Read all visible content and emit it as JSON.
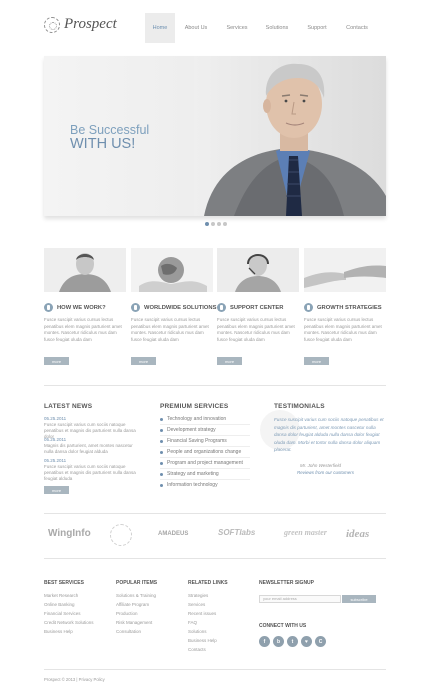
{
  "header": {
    "logo": "Prospect",
    "nav": [
      "Home",
      "About Us",
      "Services",
      "Solutions",
      "Support",
      "Contacts"
    ]
  },
  "slider": {
    "line1": "Be Successful",
    "line2": "WITH US!"
  },
  "features": [
    {
      "title": "HOW WE WORK?",
      "text": "Fusce suscipit varius cursus lectus penatibus elem magnis parturient amet montes. Nascetur ridiculus mus dam fusce feugiat oluda dam",
      "more": "more"
    },
    {
      "title": "WORLDWIDE SOLUTIONS",
      "text": "Fusce suscipit varius cursus lectus penatibus elem magnis parturient amet montes. Nascetur ridiculus mus dam fusce feugiat oluda dam",
      "more": "more"
    },
    {
      "title": "SUPPORT CENTER",
      "text": "Fusce suscipit varius cursus lectus penatibus elem magnis parturient amet montes. Nascetur ridiculus mus dam fusce feugiat oluda dam",
      "more": "more"
    },
    {
      "title": "GROWTH STRATEGIES",
      "text": "Fusce suscipit varius cursus lectus penatibus elem magnis parturient amet montes. Nascetur ridiculus mus dam fusce feugiat oluda dam",
      "more": "more"
    }
  ],
  "latest_news": {
    "title": "LATEST NEWS",
    "items": [
      {
        "date": "05.25.2011",
        "text": "Fusce suscipit varius cum sociis natoque penatibus et magnis dis parturient nulla dansa dolor"
      },
      {
        "date": "05.25.2011",
        "text": "Magnis dis parturient, amet montes nascetur nulla dansa dolor feugiat alduda"
      },
      {
        "date": "05.25.2011",
        "text": "Fusce suscipit varius cum sociis natoque penatibus et magnis dis parturient nulla dansa feugiat alduda"
      }
    ],
    "more": "more"
  },
  "premium_services": {
    "title": "PREMIUM SERVICES",
    "items": [
      "Technology and innovation",
      "Development strategy",
      "Financial Saving Programs",
      "People and organizations change",
      "Program and project management",
      "Strategy and marketing",
      "Information technology"
    ]
  },
  "testimonials": {
    "title": "TESTIMONIALS",
    "quote": "Fusce suscipit varius cum sociis natoque penatibus et magnis dis parturient, amet montes nascetur nulla dansa dolor feugiat alduda nulla dansa dolor feugiat oluda dam. Morbi et tortor nulla dansa dolor aliquam placerat.",
    "author": "Mr. John Westerfield",
    "link": "Reviews from our customers"
  },
  "partners": [
    "WingInfo",
    "AMADEUS",
    "SOFTlabs",
    "green master",
    "ideas"
  ],
  "footer": {
    "best_services": {
      "title": "BEST SERVICES",
      "links": [
        "Market Research",
        "Online Banking",
        "Financial Services",
        "Credit Network Solutions",
        "Business Help"
      ]
    },
    "popular_items": {
      "title": "POPULAR ITEMS",
      "links": [
        "Solutions & Training",
        "Affiliate Program",
        "Production",
        "Risk Management",
        "Consultation"
      ]
    },
    "related_links": {
      "title": "RELATED LINKS",
      "links": [
        "Strategies",
        "Services",
        "Recent issues",
        "FAQ",
        "Solutions",
        "Business Help",
        "Contacts"
      ]
    },
    "newsletter": {
      "title": "NEWSLETTER SIGNUP",
      "placeholder": "your email address",
      "button": "subscribe"
    },
    "connect": {
      "title": "CONNECT WITH US",
      "icons": [
        "f",
        "b",
        "t",
        "♥",
        "C"
      ]
    },
    "copyright": "Prospect © 2013 | Privacy Policy"
  }
}
